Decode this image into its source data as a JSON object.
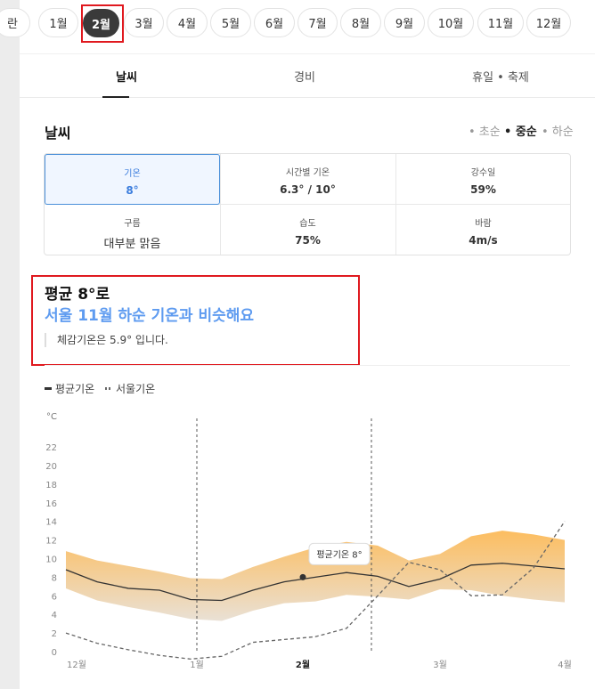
{
  "months": [
    {
      "label": "1월",
      "active": false
    },
    {
      "label": "2월",
      "active": true
    },
    {
      "label": "3월",
      "active": false
    },
    {
      "label": "4월",
      "active": false
    },
    {
      "label": "5월",
      "active": false
    },
    {
      "label": "6월",
      "active": false
    },
    {
      "label": "7월",
      "active": false
    },
    {
      "label": "8월",
      "active": false
    },
    {
      "label": "9월",
      "active": false
    },
    {
      "label": "10월",
      "active": false
    },
    {
      "label": "11월",
      "active": false
    },
    {
      "label": "12월",
      "active": false
    }
  ],
  "month_partial": "란",
  "tabs": [
    {
      "label": "날씨",
      "active": true
    },
    {
      "label": "경비",
      "active": false
    },
    {
      "label": "휴일 • 축제",
      "active": false
    }
  ],
  "weather": {
    "title": "날씨",
    "segments": [
      "• 초순",
      "• 중순",
      "• 하순"
    ],
    "active_segment": 1,
    "cells": [
      {
        "label": "기온",
        "value": "8°"
      },
      {
        "label": "시간별 기온",
        "value": "6.3° / 10°"
      },
      {
        "label": "강수일",
        "value": "59%"
      },
      {
        "label": "구름",
        "value": "대부분 맑음"
      },
      {
        "label": "습도",
        "value": "75%"
      },
      {
        "label": "바람",
        "value": "4m/s"
      }
    ]
  },
  "summary": {
    "title": "평균 8°로",
    "subtitle": "서울 11월 하순 기온과 비슷해요",
    "feels_like": "체감기온은 5.9° 입니다."
  },
  "legend": [
    {
      "label": "평균기온",
      "color": "#333333",
      "style": "solid"
    },
    {
      "label": "서울기온",
      "color": "#666666",
      "style": "dashed"
    }
  ],
  "chart_data": {
    "type": "area",
    "unit_label": "°C",
    "y_ticks": [
      0,
      2,
      4,
      6,
      8,
      10,
      12,
      14,
      16,
      18,
      20,
      22
    ],
    "ylim": [
      0,
      24
    ],
    "x_tick_labels": [
      "12월",
      "1월",
      "2월",
      "3월",
      "4월"
    ],
    "highlight_tick": "2월",
    "tooltip": "평균기온 8°",
    "band_color_top": "#fcb64e",
    "band_color_bottom": "#e7ddd0",
    "series": [
      {
        "name": "평균기온",
        "x": [
          0,
          0.5,
          1,
          1.5,
          2,
          2.5,
          3,
          3.5,
          4,
          4.5,
          5,
          5.5,
          6,
          6.5,
          7,
          7.5,
          8
        ],
        "y": [
          8.8,
          7.5,
          6.8,
          6.6,
          5.6,
          5.5,
          6.6,
          7.5,
          8.0,
          8.5,
          8.1,
          7.0,
          7.8,
          9.3,
          9.5,
          9.2,
          8.9
        ],
        "upper": [
          10.8,
          9.8,
          9.2,
          8.6,
          7.9,
          7.8,
          9.1,
          10.2,
          11.2,
          11.8,
          11.4,
          9.8,
          10.5,
          12.4,
          13.0,
          12.6,
          12.0
        ],
        "lower": [
          6.8,
          5.5,
          4.8,
          4.2,
          3.5,
          3.3,
          4.4,
          5.2,
          5.4,
          6.1,
          5.9,
          5.6,
          6.7,
          6.6,
          6.0,
          5.6,
          5.3
        ]
      },
      {
        "name": "서울기온",
        "x": [
          0,
          0.5,
          1,
          1.5,
          2,
          2.5,
          3,
          3.5,
          4,
          4.5,
          5,
          5.5,
          6,
          6.5,
          7,
          7.5,
          8
        ],
        "y": [
          2.0,
          0.9,
          0.2,
          -0.4,
          -0.8,
          -0.5,
          1.0,
          1.3,
          1.6,
          2.5,
          6.0,
          9.6,
          8.8,
          6.0,
          6.1,
          9.0,
          14.0
        ]
      }
    ],
    "current_x": 3.8,
    "current_y": 8.0,
    "x_range": [
      0,
      8
    ],
    "band_x_range": [
      2.1,
      4.9
    ]
  }
}
